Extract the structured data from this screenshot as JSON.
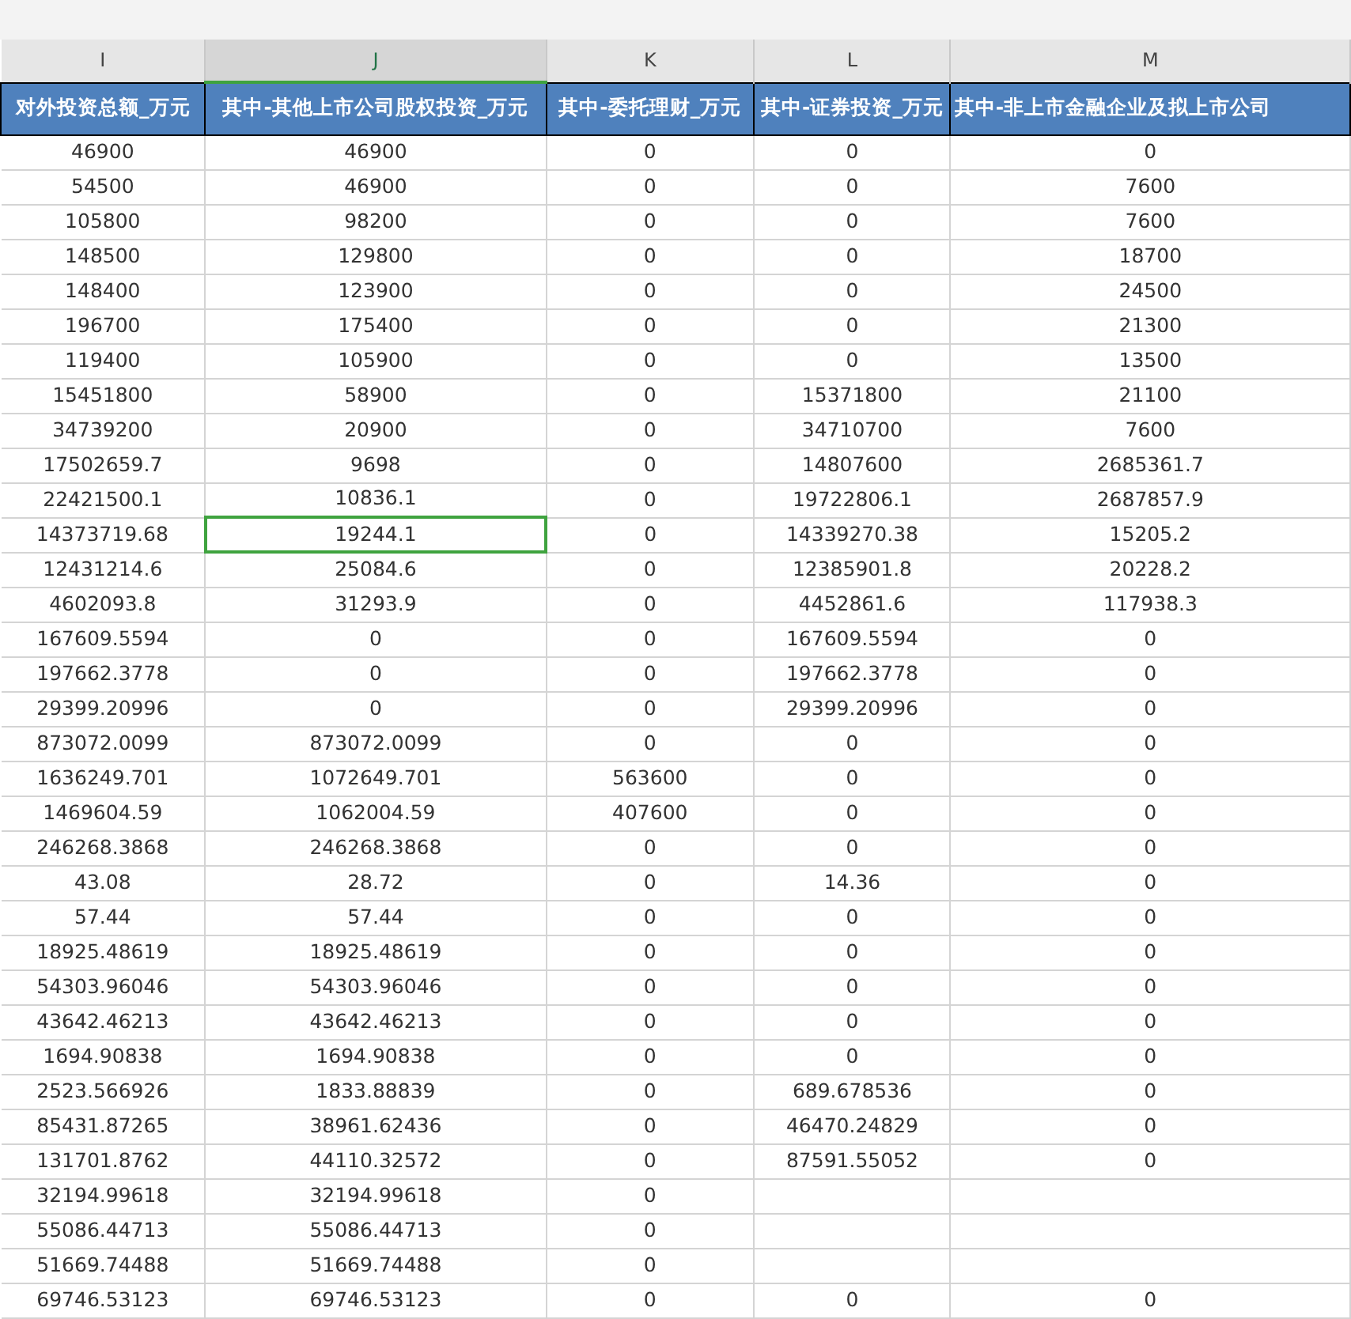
{
  "columns": [
    {
      "letter": "I",
      "heading": "对外投资总额_万元",
      "selected": false
    },
    {
      "letter": "J",
      "heading": "其中-其他上市公司股权投资_万元",
      "selected": true
    },
    {
      "letter": "K",
      "heading": "其中-委托理财_万元",
      "selected": false
    },
    {
      "letter": "L",
      "heading": "其中-证券投资_万元",
      "selected": false
    },
    {
      "letter": "M",
      "heading": "其中-非上市金融企业及拟上市公司",
      "selected": false
    }
  ],
  "rows": [
    {
      "selected": false,
      "values": [
        "46900",
        "46900",
        "0",
        "0",
        "0"
      ]
    },
    {
      "selected": false,
      "values": [
        "54500",
        "46900",
        "0",
        "0",
        "7600"
      ]
    },
    {
      "selected": false,
      "values": [
        "105800",
        "98200",
        "0",
        "0",
        "7600"
      ]
    },
    {
      "selected": false,
      "values": [
        "148500",
        "129800",
        "0",
        "0",
        "18700"
      ]
    },
    {
      "selected": false,
      "values": [
        "148400",
        "123900",
        "0",
        "0",
        "24500"
      ]
    },
    {
      "selected": false,
      "values": [
        "196700",
        "175400",
        "0",
        "0",
        "21300"
      ]
    },
    {
      "selected": false,
      "values": [
        "119400",
        "105900",
        "0",
        "0",
        "13500"
      ]
    },
    {
      "selected": false,
      "values": [
        "15451800",
        "58900",
        "0",
        "15371800",
        "21100"
      ]
    },
    {
      "selected": false,
      "values": [
        "34739200",
        "20900",
        "0",
        "34710700",
        "7600"
      ]
    },
    {
      "selected": false,
      "values": [
        "17502659.7",
        "9698",
        "0",
        "14807600",
        "2685361.7"
      ]
    },
    {
      "selected": false,
      "values": [
        "22421500.1",
        "10836.1",
        "0",
        "19722806.1",
        "2687857.9"
      ]
    },
    {
      "selected": true,
      "values": [
        "14373719.68",
        "19244.1",
        "0",
        "14339270.38",
        "15205.2"
      ]
    },
    {
      "selected": false,
      "values": [
        "12431214.6",
        "25084.6",
        "0",
        "12385901.8",
        "20228.2"
      ]
    },
    {
      "selected": false,
      "values": [
        "4602093.8",
        "31293.9",
        "0",
        "4452861.6",
        "117938.3"
      ]
    },
    {
      "selected": false,
      "values": [
        "167609.5594",
        "0",
        "0",
        "167609.5594",
        "0"
      ]
    },
    {
      "selected": false,
      "values": [
        "197662.3778",
        "0",
        "0",
        "197662.3778",
        "0"
      ]
    },
    {
      "selected": false,
      "values": [
        "29399.20996",
        "0",
        "0",
        "29399.20996",
        "0"
      ]
    },
    {
      "selected": false,
      "values": [
        "873072.0099",
        "873072.0099",
        "0",
        "0",
        "0"
      ]
    },
    {
      "selected": false,
      "values": [
        "1636249.701",
        "1072649.701",
        "563600",
        "0",
        "0"
      ]
    },
    {
      "selected": false,
      "values": [
        "1469604.59",
        "1062004.59",
        "407600",
        "0",
        "0"
      ]
    },
    {
      "selected": false,
      "values": [
        "246268.3868",
        "246268.3868",
        "0",
        "0",
        "0"
      ]
    },
    {
      "selected": false,
      "values": [
        "43.08",
        "28.72",
        "0",
        "14.36",
        "0"
      ]
    },
    {
      "selected": false,
      "values": [
        "57.44",
        "57.44",
        "0",
        "0",
        "0"
      ]
    },
    {
      "selected": false,
      "values": [
        "18925.48619",
        "18925.48619",
        "0",
        "0",
        "0"
      ]
    },
    {
      "selected": false,
      "values": [
        "54303.96046",
        "54303.96046",
        "0",
        "0",
        "0"
      ]
    },
    {
      "selected": false,
      "values": [
        "43642.46213",
        "43642.46213",
        "0",
        "0",
        "0"
      ]
    },
    {
      "selected": false,
      "values": [
        "1694.90838",
        "1694.90838",
        "0",
        "0",
        "0"
      ]
    },
    {
      "selected": false,
      "values": [
        "2523.566926",
        "1833.88839",
        "0",
        "689.678536",
        "0"
      ]
    },
    {
      "selected": false,
      "values": [
        "85431.87265",
        "38961.62436",
        "0",
        "46470.24829",
        "0"
      ]
    },
    {
      "selected": false,
      "values": [
        "131701.8762",
        "44110.32572",
        "0",
        "87591.55052",
        "0"
      ]
    },
    {
      "selected": false,
      "values": [
        "32194.99618",
        "32194.99618",
        "0"
      ]
    },
    {
      "selected": false,
      "values": [
        "55086.44713",
        "55086.44713",
        "0"
      ]
    },
    {
      "selected": false,
      "values": [
        "51669.74488",
        "51669.74488",
        "0"
      ]
    },
    {
      "selected": false,
      "values": [
        "69746.53123",
        "69746.53123",
        "0",
        "0",
        "0"
      ]
    }
  ]
}
